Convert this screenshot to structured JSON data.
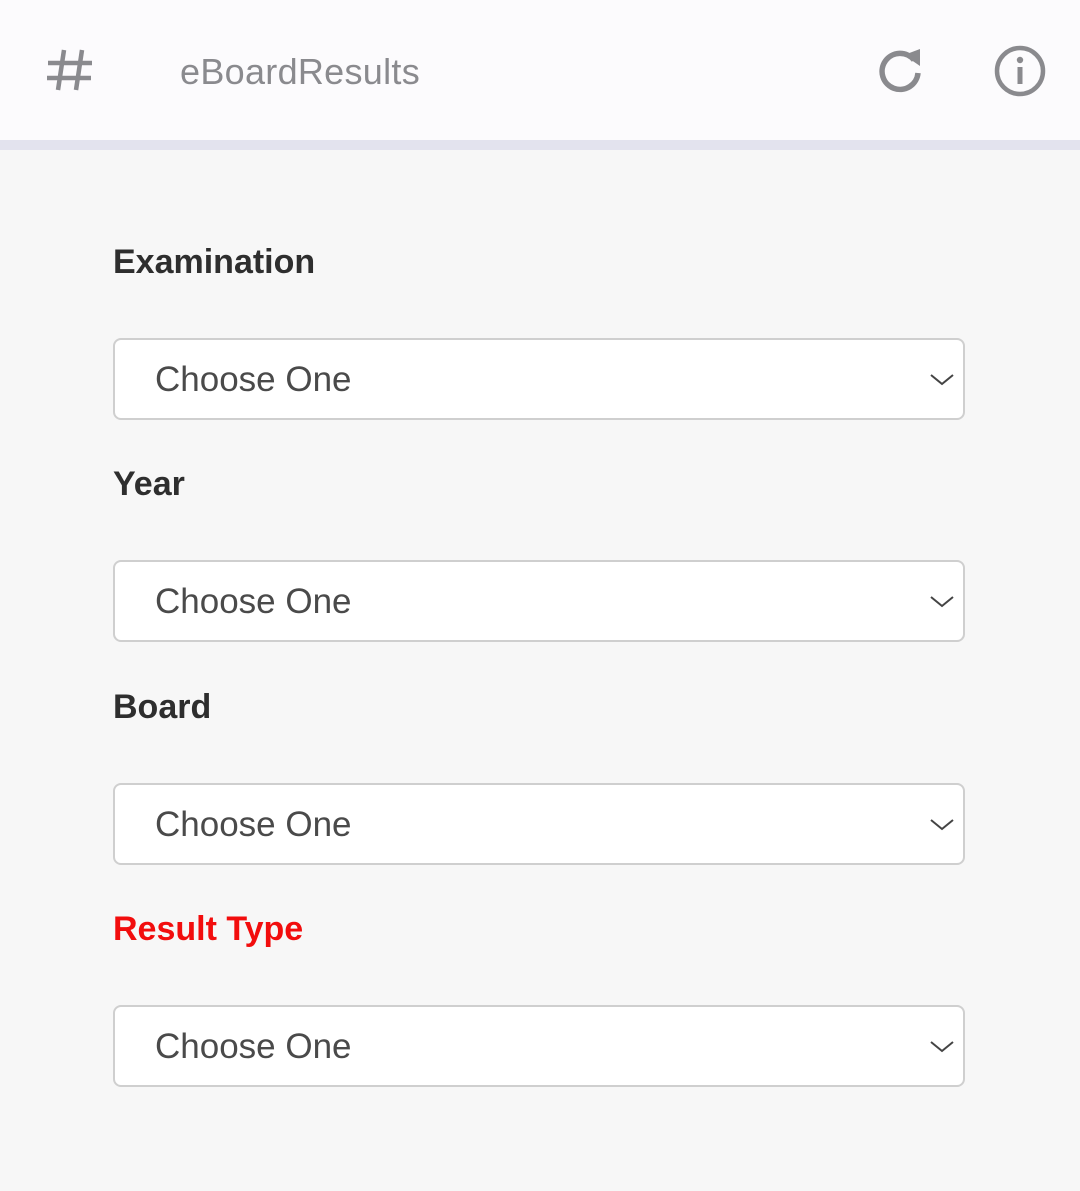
{
  "appbar": {
    "title": "eBoardResults",
    "icons": {
      "menu": "hash-icon",
      "refresh": "refresh-icon",
      "info": "info-icon"
    }
  },
  "form": {
    "fields": [
      {
        "label": "Examination",
        "value": "Choose One"
      },
      {
        "label": "Year",
        "value": "Choose One"
      },
      {
        "label": "Board",
        "value": "Choose One"
      },
      {
        "label": "Result Type",
        "value": "Choose One",
        "label_color": "#f20d0d"
      }
    ]
  },
  "colors": {
    "appbar_bg": "#fcfbfd",
    "appbar_divider": "#e3e3ee",
    "page_bg": "#f7f7f7",
    "label_text": "#2e2e2e",
    "alert_label": "#f20d0d",
    "icon_gray": "#8a8a8e"
  }
}
